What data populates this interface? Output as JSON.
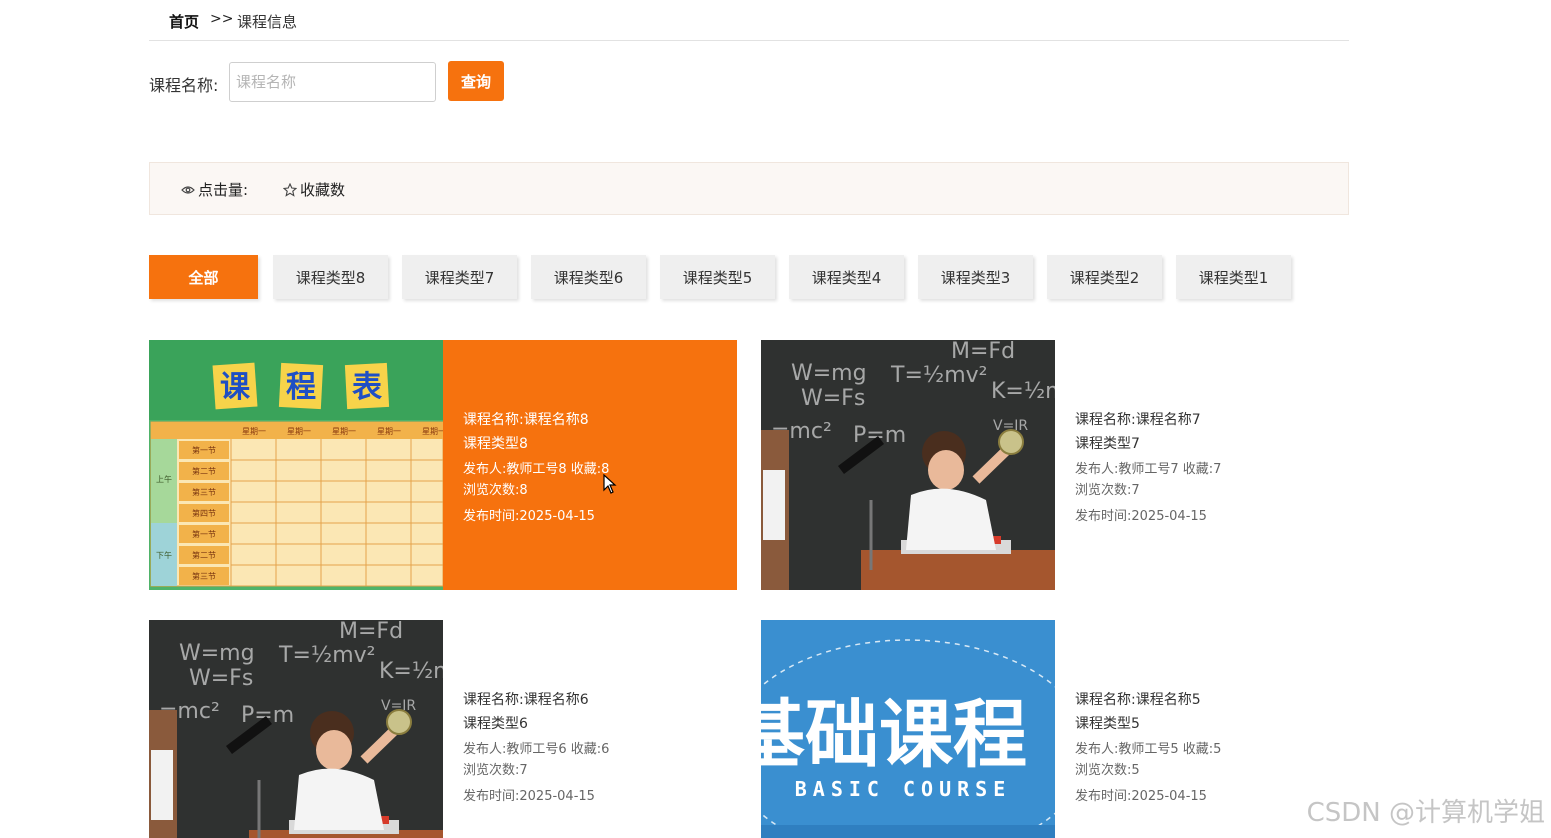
{
  "breadcrumb": {
    "home": "首页",
    "separator": ">>",
    "current": "课程信息"
  },
  "search": {
    "label": "课程名称:",
    "placeholder": "课程名称",
    "value": "",
    "button": "查询"
  },
  "sort": {
    "views_label": "点击量:",
    "favorites_label": "收藏数"
  },
  "tabs": [
    "全部",
    "课程类型8",
    "课程类型7",
    "课程类型6",
    "课程类型5",
    "课程类型4",
    "课程类型3",
    "课程类型2",
    "课程类型1"
  ],
  "active_tab": "全部",
  "courses": [
    {
      "name": "课程名称:课程名称8",
      "type": "课程类型8",
      "publisher": "发布人:教师工号8",
      "favorites": "收藏:8",
      "views": "浏览次数:8",
      "time": "发布时间:2025-04-15",
      "image": "timetable"
    },
    {
      "name": "课程名称:课程名称7",
      "type": "课程类型7",
      "publisher": "发布人:教师工号7",
      "favorites": "收藏:7",
      "views": "浏览次数:7",
      "time": "发布时间:2025-04-15",
      "image": "blackboard-boy"
    },
    {
      "name": "课程名称:课程名称6",
      "type": "课程类型6",
      "publisher": "发布人:教师工号6",
      "favorites": "收藏:6",
      "views": "浏览次数:7",
      "time": "发布时间:2025-04-15",
      "image": "blackboard-boy"
    },
    {
      "name": "课程名称:课程名称5",
      "type": "课程类型5",
      "publisher": "发布人:教师工号5",
      "favorites": "收藏:5",
      "views": "浏览次数:5",
      "time": "发布时间:2025-04-15",
      "image": "basic-course"
    }
  ],
  "images": {
    "timetable": {
      "chars": [
        "课",
        "程",
        "表"
      ],
      "days": [
        "星期一",
        "星期一",
        "星期一",
        "星期一",
        "星期一"
      ],
      "periods": [
        "第一节",
        "第二节",
        "第三节",
        "第四节",
        "第一节",
        "第二节",
        "第三节"
      ],
      "am": "上午",
      "pm": "下午"
    },
    "blackboard": {
      "formulas": [
        "W=mg",
        "W=Fs",
        "T=½mv²",
        "K=½m",
        "=mc²",
        "P=m",
        "M=Fd",
        "V=IR"
      ]
    },
    "basic_course": {
      "title": "基础课程",
      "subtitle": "BASIC COURSE"
    }
  },
  "watermark": "CSDN @计算机学姐",
  "colors": {
    "accent": "#f6720e",
    "tab_bg": "#efefef",
    "sortbar_bg": "#fbf7f4"
  }
}
